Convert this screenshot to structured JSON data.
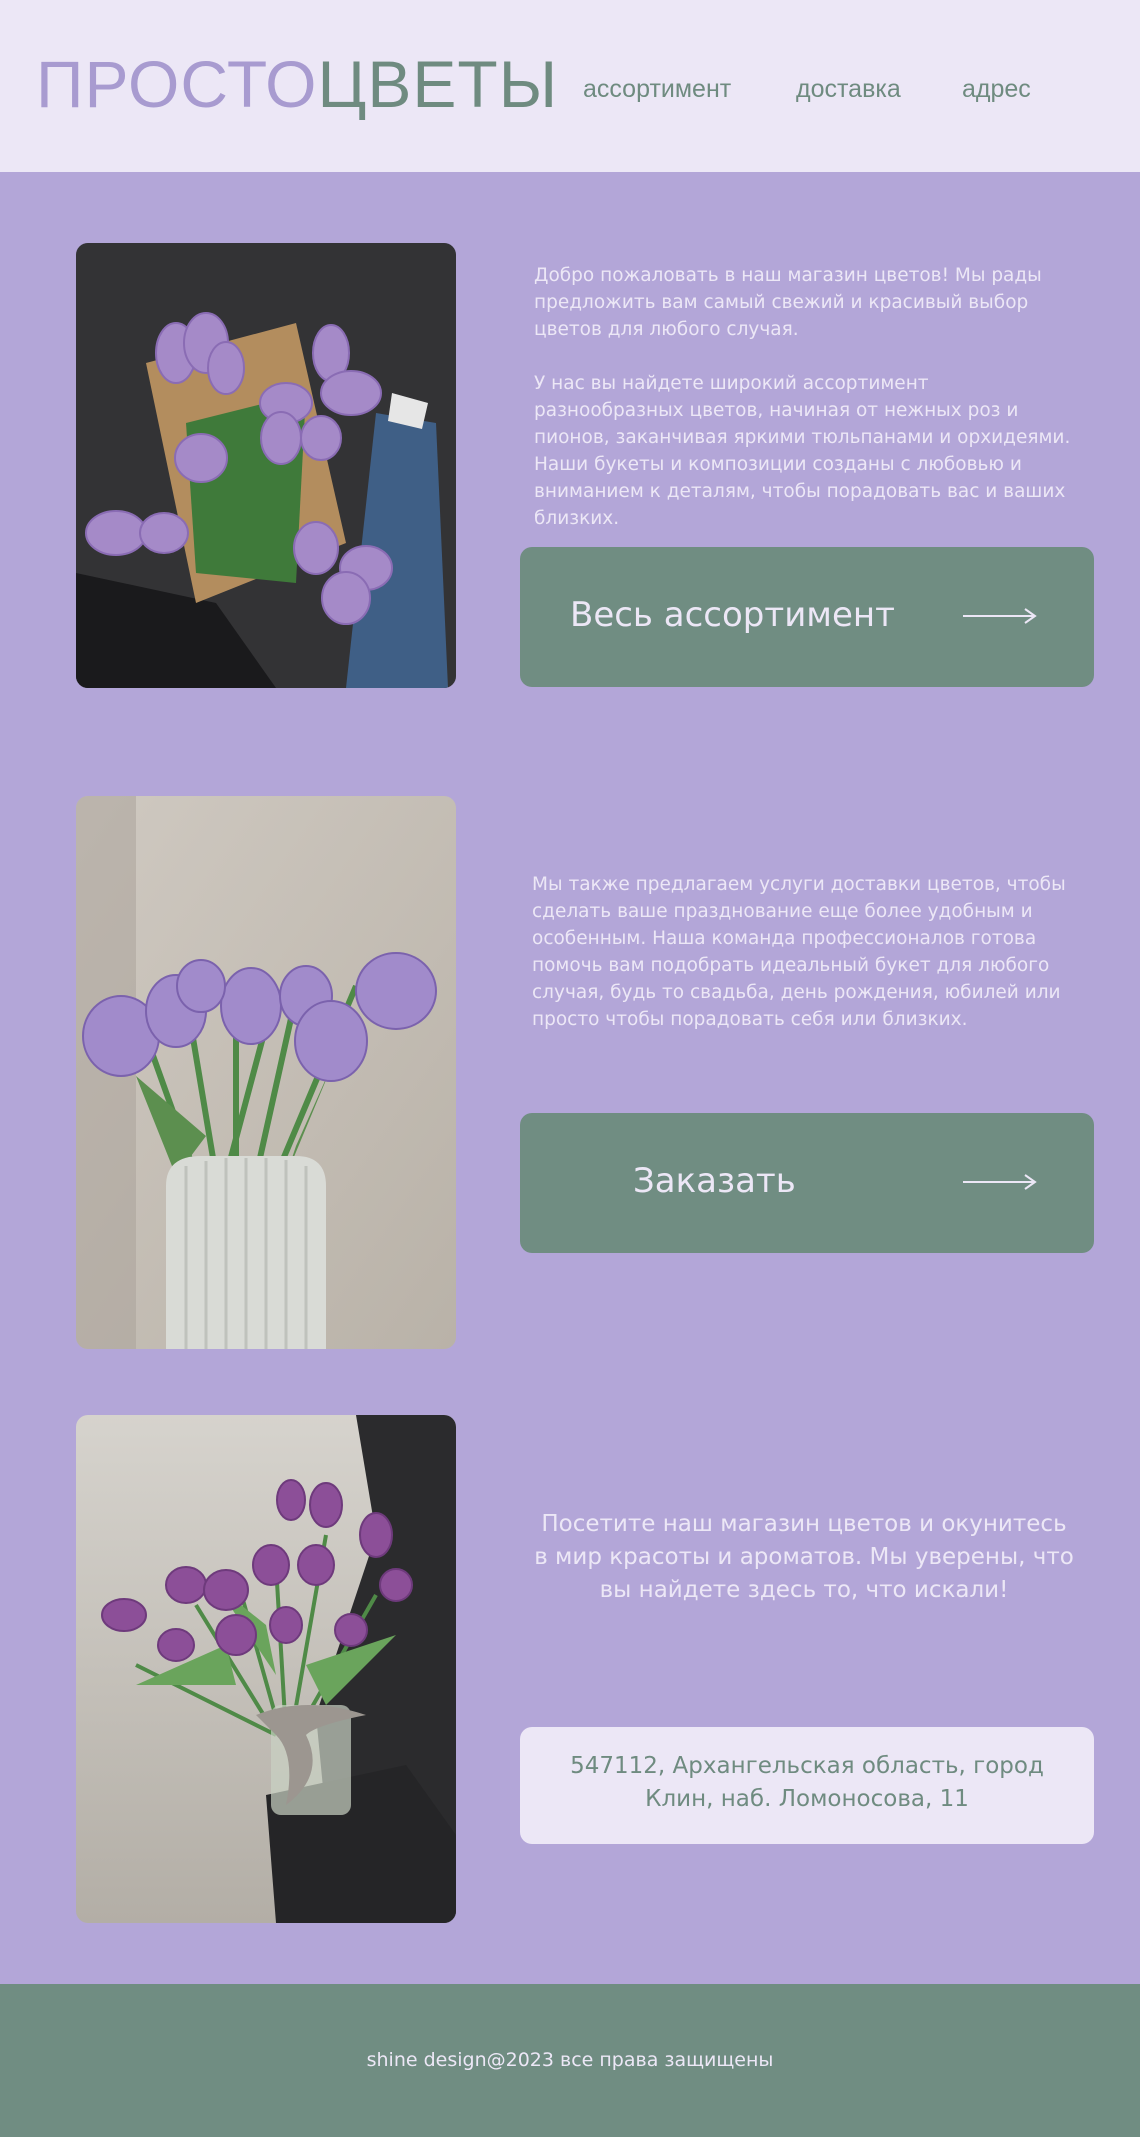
{
  "header": {
    "logo_part1": "ПРОСТО",
    "logo_part2": "ЦВЕТЫ",
    "nav": [
      "ассортимент",
      "доставка",
      "адрес"
    ]
  },
  "sections": [
    {
      "photo_icon": "tulip-bouquet-photo",
      "paragraphs": [
        "Добро пожаловать в наш магазин цветов! Мы рады предложить вам самый свежий и красивый выбор цветов для любого случая.",
        "У нас вы найдете широкий ассортимент разнообразных цветов, начиная от нежных роз и пионов, заканчивая яркими тюльпанами и орхидеями. Наши букеты и композиции созданы с любовью и вниманием к деталям, чтобы порадовать вас и ваших близких."
      ],
      "button_label": "Весь ассортимент",
      "button_icon": "arrow-right-icon"
    },
    {
      "photo_icon": "tulips-in-vase-photo",
      "paragraphs": [
        "Мы также предлагаем услуги доставки цветов, чтобы сделать ваше празднование еще более удобным и особенным. Наша команда профессионалов готова помочь вам подобрать идеальный букет для любого случая, будь то свадьба, день рождения, юбилей или просто чтобы порадовать себя или близких."
      ],
      "button_label": "Заказать",
      "button_icon": "arrow-right-icon"
    },
    {
      "photo_icon": "tulips-glass-vase-photo",
      "paragraphs": [
        "Посетите наш магазин цветов и окунитесь в мир красоты и ароматов. Мы уверены, что вы найдете здесь то, что искали!"
      ],
      "address": "547112, Архангельская область, город Клин, наб. Ломоносова, 11"
    }
  ],
  "footer": {
    "text": "shine design@2023 все права защищены"
  },
  "colors": {
    "page_background": "#b3a6d8",
    "header_background": "#ece7f6",
    "accent_green": "#708d82",
    "text_light": "#ece7f6",
    "logo_lavender": "#a89bd0"
  }
}
